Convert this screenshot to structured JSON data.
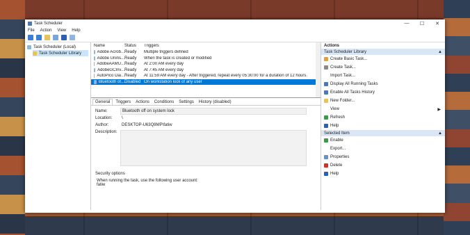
{
  "window": {
    "title": "Task Scheduler",
    "controls": [
      "—",
      "☐",
      "✕"
    ]
  },
  "menu": [
    "File",
    "Action",
    "View",
    "Help"
  ],
  "tree": [
    {
      "label": "Task Scheduler (Local)"
    },
    {
      "label": "Task Scheduler Library"
    }
  ],
  "tasklist": {
    "headers": [
      "Name",
      "Status",
      "Triggers"
    ],
    "rows": [
      {
        "name": "Adobe Acrob...",
        "status": "Ready",
        "trigger": "Multiple triggers defined"
      },
      {
        "name": "Adobe Unins...",
        "status": "Ready",
        "trigger": "When the task is created or modified"
      },
      {
        "name": "AdobeAAMU...",
        "status": "Ready",
        "trigger": "At 2:00 AM every day"
      },
      {
        "name": "AdobeGCInv...",
        "status": "Ready",
        "trigger": "At 7:45 AM every day"
      },
      {
        "name": "AutoPico Dai...",
        "status": "Ready",
        "trigger": "At 11:59 AM every day - After triggered, repeat every 05:30:00 for a duration of 12 hours."
      },
      {
        "name": "Bluetooth of...",
        "status": "Disabled",
        "trigger": "On workstation lock of any user"
      }
    ]
  },
  "tabs": [
    "General",
    "Triggers",
    "Actions",
    "Conditions",
    "Settings",
    "History (disabled)"
  ],
  "general": {
    "name_label": "Name:",
    "name_value": "Bluetooth off on system lock",
    "location_label": "Location:",
    "location_value": "\\",
    "author_label": "Author:",
    "author_value": "DESKTOP-U63Q8MP\\fatiw",
    "description_label": "Description:",
    "security_label": "Security options",
    "security_text": "When running the task, use the following user account:",
    "account": "fatiw"
  },
  "actions": {
    "header": "Actions",
    "section1": "Task Scheduler Library",
    "items1": [
      {
        "label": "Create Basic Task...",
        "color": "#d9a441"
      },
      {
        "label": "Create Task...",
        "color": "#8a8a8a"
      },
      {
        "label": "Import Task...",
        "color": "#ffffff"
      },
      {
        "label": "Display All Running Tasks",
        "color": "#4a78b8"
      },
      {
        "label": "Enable All Tasks History",
        "color": "#4a78b8"
      },
      {
        "label": "New Folder...",
        "color": "#e8c25a"
      },
      {
        "label": "View",
        "color": "#ffffff",
        "submenu": "▶"
      },
      {
        "label": "Refresh",
        "color": "#3a9a4a"
      },
      {
        "label": "Help",
        "color": "#2f5fb0"
      }
    ],
    "section2": "Selected Item",
    "items2": [
      {
        "label": "Enable",
        "color": "#3a9a4a"
      },
      {
        "label": "Export...",
        "color": "#ffffff"
      },
      {
        "label": "Properties",
        "color": "#6a8fc0"
      },
      {
        "label": "Delete",
        "color": "#d0302a"
      },
      {
        "label": "Help",
        "color": "#2f5fb0"
      }
    ]
  }
}
